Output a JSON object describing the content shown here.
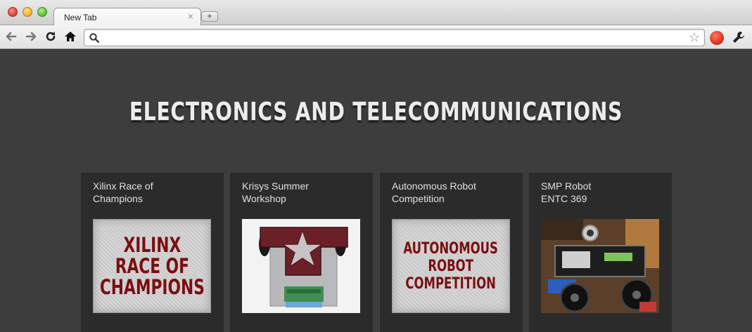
{
  "browser": {
    "tab_title": "New Tab",
    "tab_close": "×",
    "new_tab": "+",
    "address_value": "",
    "address_placeholder": ""
  },
  "page": {
    "title": "ELECTRONICS AND TELECOMMUNICATIONS"
  },
  "cards": [
    {
      "title_line1": "Xilinx Race of",
      "title_line2": "Champions",
      "thumb_lines": [
        "XILINX",
        "RACE OF",
        "CHAMPIONS"
      ]
    },
    {
      "title_line1": "Krisys Summer",
      "title_line2": "Workshop"
    },
    {
      "title_line1": "Autonomous Robot",
      "title_line2": "Competition",
      "thumb_lines": [
        "AUTONOMOUS",
        "ROBOT",
        "COMPETITION"
      ]
    },
    {
      "title_line1": "SMP Robot",
      "title_line2": "ENTC 369"
    }
  ],
  "colors": {
    "page_bg": "#3d3d3d",
    "card_bg": "#2b2b2b",
    "thumb_text": "#7a0e12"
  }
}
